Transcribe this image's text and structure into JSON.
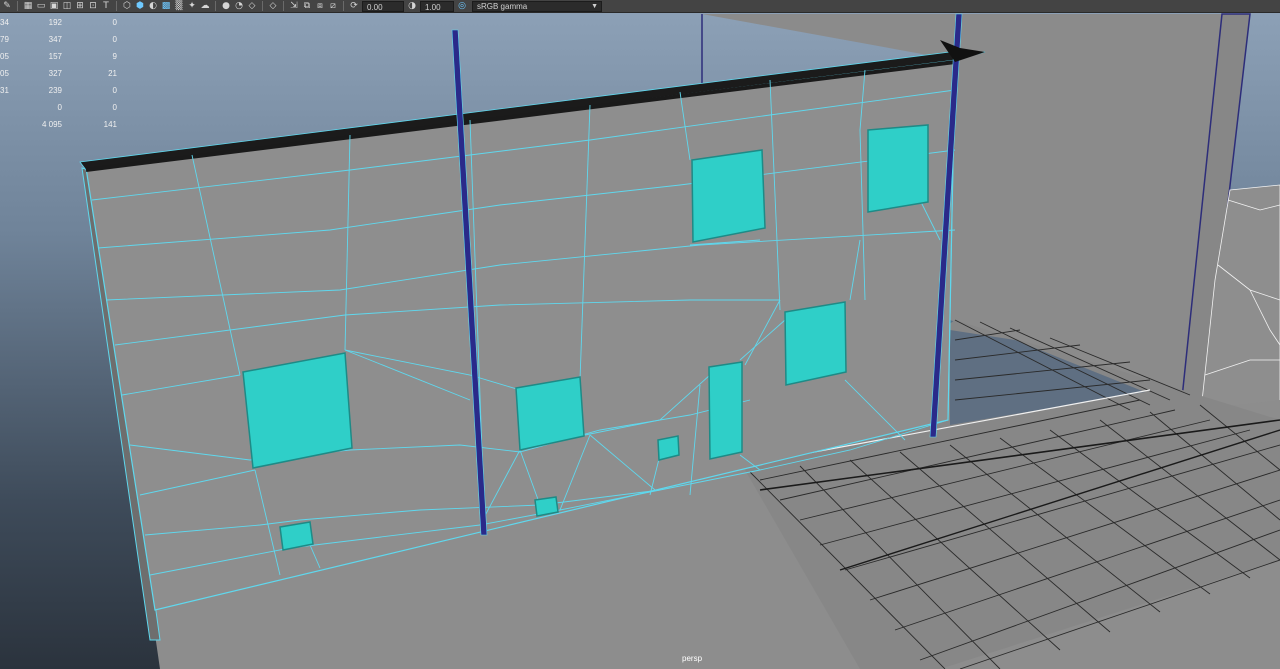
{
  "toolbar": {
    "exposure_value": "0.00",
    "gamma_value": "1.00",
    "color_space": "sRGB gamma",
    "icons": [
      "pencil-icon",
      "grid-icon",
      "film-gate-icon",
      "resolution-gate-icon",
      "gate-mask-icon",
      "field-chart-icon",
      "wireframe-icon",
      "smooth-shade-icon",
      "default-material-icon",
      "textured-icon",
      "xray-icon",
      "lights-icon",
      "shadows-icon",
      "ambient-occlusion-icon",
      "motion-blur-icon",
      "isolate-icon",
      "select-camera-icon",
      "xray-joints-icon",
      "backface-icon",
      "exposure-icon",
      "gamma-icon",
      "color-management-icon"
    ]
  },
  "hud": {
    "rows": [
      {
        "c1": "34",
        "c2": "192",
        "c3": "0"
      },
      {
        "c1": "79",
        "c2": "347",
        "c3": "0"
      },
      {
        "c1": "05",
        "c2": "157",
        "c3": "9"
      },
      {
        "c1": "05",
        "c2": "327",
        "c3": "21"
      },
      {
        "c1": "31",
        "c2": "239",
        "c3": "0"
      },
      {
        "c1": "",
        "c2": "0",
        "c3": "0"
      },
      {
        "c1": "",
        "c2": "4 095",
        "c3": "141"
      }
    ]
  },
  "viewport": {
    "camera_label": "persp",
    "wire_color": "#5fd8ee",
    "selected_face_color": "#2fcfc8",
    "wall_color": "#8c8c8c",
    "ground_color": "#8a8a8a",
    "pole_color": "#2a2a8a"
  }
}
